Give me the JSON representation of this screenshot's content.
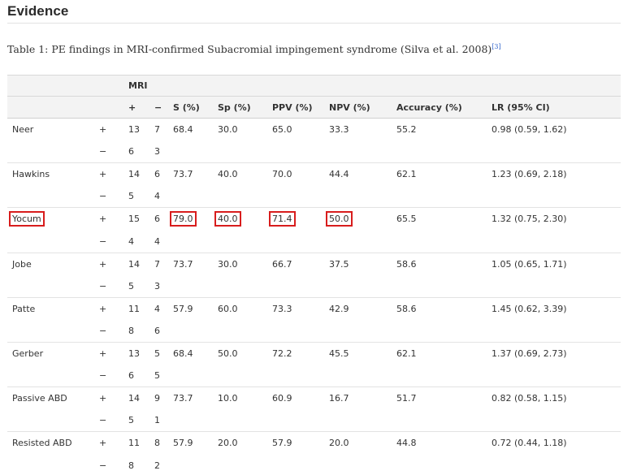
{
  "heading": "Evidence",
  "caption": {
    "text": "Table 1: PE findings in MRI-confirmed Subacromial impingement syndrome (Silva et al. 2008)",
    "ref": "[3]"
  },
  "table": {
    "group_header": "MRI",
    "columns": [
      "+",
      "−",
      "S (%)",
      "Sp (%)",
      "PPV (%)",
      "NPV (%)",
      "Accuracy (%)",
      "LR (95% CI)"
    ],
    "highlight_color": "#d81d1d",
    "rows": [
      {
        "name": "Neer",
        "plus": [
          "+",
          "13",
          "7",
          "68.4",
          "30.0",
          "65.0",
          "33.3",
          "55.2",
          "0.98 (0.59, 1.62)"
        ],
        "minus": [
          "−",
          "6",
          "3"
        ]
      },
      {
        "name": "Hawkins",
        "plus": [
          "+",
          "14",
          "6",
          "73.7",
          "40.0",
          "70.0",
          "44.4",
          "62.1",
          "1.23 (0.69, 2.18)"
        ],
        "minus": [
          "−",
          "5",
          "4"
        ]
      },
      {
        "name": "Yocum",
        "highlighted": true,
        "plus": [
          "+",
          "15",
          "6",
          "79.0",
          "40.0",
          "71.4",
          "50.0",
          "65.5",
          "1.32 (0.75, 2.30)"
        ],
        "minus": [
          "−",
          "4",
          "4"
        ]
      },
      {
        "name": "Jobe",
        "plus": [
          "+",
          "14",
          "7",
          "73.7",
          "30.0",
          "66.7",
          "37.5",
          "58.6",
          "1.05 (0.65, 1.71)"
        ],
        "minus": [
          "−",
          "5",
          "3"
        ]
      },
      {
        "name": "Patte",
        "plus": [
          "+",
          "11",
          "4",
          "57.9",
          "60.0",
          "73.3",
          "42.9",
          "58.6",
          "1.45 (0.62, 3.39)"
        ],
        "minus": [
          "−",
          "8",
          "6"
        ]
      },
      {
        "name": "Gerber",
        "plus": [
          "+",
          "13",
          "5",
          "68.4",
          "50.0",
          "72.2",
          "45.5",
          "62.1",
          "1.37 (0.69, 2.73)"
        ],
        "minus": [
          "−",
          "6",
          "5"
        ]
      },
      {
        "name": "Passive ABD",
        "plus": [
          "+",
          "14",
          "9",
          "73.7",
          "10.0",
          "60.9",
          "16.7",
          "51.7",
          "0.82 (0.58, 1.15)"
        ],
        "minus": [
          "−",
          "5",
          "1"
        ]
      },
      {
        "name": "Resisted ABD",
        "plus": [
          "+",
          "11",
          "8",
          "57.9",
          "20.0",
          "57.9",
          "20.0",
          "44.8",
          "0.72 (0.44, 1.18)"
        ],
        "minus": [
          "−",
          "8",
          "2"
        ]
      }
    ]
  }
}
